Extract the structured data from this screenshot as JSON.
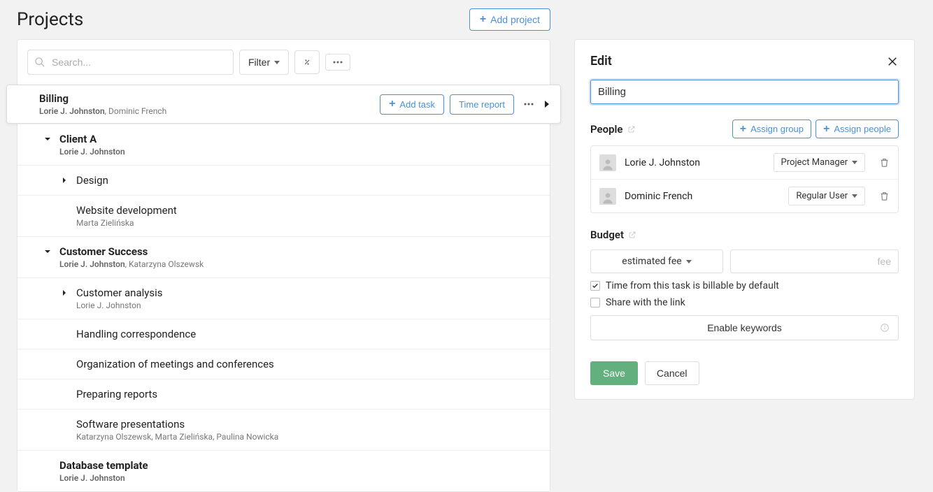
{
  "header": {
    "title": "Projects",
    "add_project_label": "Add project"
  },
  "toolbar": {
    "search_placeholder": "Search...",
    "filter_label": "Filter"
  },
  "selected_project": {
    "title": "Billing",
    "people_primary": "Lorie J. Johnston",
    "people_secondary": ", Dominic French",
    "add_task_label": "Add task",
    "time_report_label": "Time report"
  },
  "tree": [
    {
      "level": 2,
      "heading": true,
      "toggle": "down",
      "title": "Client A",
      "sub_primary": "Lorie J. Johnston",
      "sub_secondary": ""
    },
    {
      "level": 3,
      "heading": false,
      "toggle": "right",
      "title": "Design",
      "sub_primary": "",
      "sub_secondary": ""
    },
    {
      "level": 3,
      "heading": false,
      "toggle": "",
      "title": "Website development",
      "sub_primary": "Marta Zielińska",
      "sub_secondary": ""
    },
    {
      "level": 2,
      "heading": true,
      "toggle": "down",
      "title": "Customer Success",
      "sub_primary": "Lorie J. Johnston",
      "sub_secondary": ", Katarzyna Olszewsk"
    },
    {
      "level": 3,
      "heading": false,
      "toggle": "right",
      "title": "Customer analysis",
      "sub_primary": "Lorie J. Johnston",
      "sub_secondary": ""
    },
    {
      "level": 3,
      "heading": false,
      "toggle": "",
      "title": "Handling correspondence",
      "sub_primary": "",
      "sub_secondary": ""
    },
    {
      "level": 3,
      "heading": false,
      "toggle": "",
      "title": "Organization of meetings and conferences",
      "sub_primary": "",
      "sub_secondary": ""
    },
    {
      "level": 3,
      "heading": false,
      "toggle": "",
      "title": "Preparing reports",
      "sub_primary": "",
      "sub_secondary": ""
    },
    {
      "level": 3,
      "heading": false,
      "toggle": "",
      "title": "Software presentations",
      "sub_primary": "Katarzyna Olszewsk, Marta Zielińska, Paulina Nowicka",
      "sub_secondary": ""
    },
    {
      "level": 2,
      "heading": true,
      "toggle": "",
      "title": "Database template",
      "sub_primary": "Lorie J. Johnston",
      "sub_secondary": ""
    }
  ],
  "edit": {
    "title": "Edit",
    "name_value": "Billing",
    "people_label": "People",
    "assign_group_label": "Assign group",
    "assign_people_label": "Assign people",
    "people": [
      {
        "name": "Lorie J. Johnston",
        "role": "Project Manager"
      },
      {
        "name": "Dominic French",
        "role": "Regular User"
      }
    ],
    "budget_label": "Budget",
    "budget_type": "estimated fee",
    "fee_placeholder": "fee",
    "billable_label": "Time from this task is billable by default",
    "share_label": "Share with the link",
    "keywords_label": "Enable keywords",
    "save_label": "Save",
    "cancel_label": "Cancel"
  }
}
